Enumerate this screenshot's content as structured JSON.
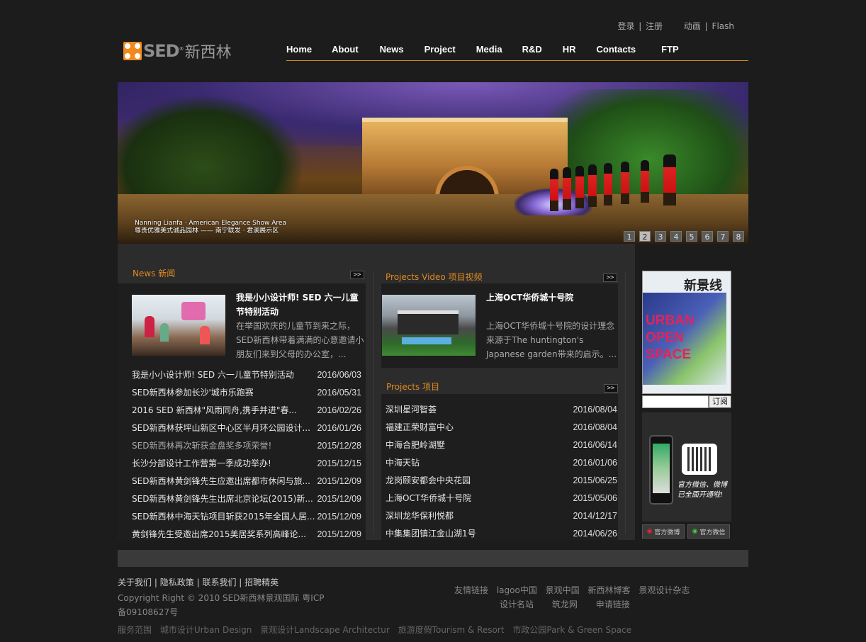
{
  "top_links": {
    "login": "登录",
    "register": "注册",
    "anim": "动画",
    "flash": "Flash",
    "sep": "|"
  },
  "logo": {
    "brand": "SED",
    "reg": "®",
    "cn": "新西林"
  },
  "nav": [
    "Home",
    "About",
    "News",
    "Project",
    "Media",
    "R&D",
    "HR",
    "Contacts",
    "FTP"
  ],
  "banner": {
    "caption_en": "Nanning Lianfa · American Elegance Show Area",
    "caption_cn": "尊贵优雅美式诚品园林 —— 南宁联发 · 君澜展示区",
    "pages": [
      "1",
      "2",
      "3",
      "4",
      "5",
      "6",
      "7",
      "8"
    ],
    "active_page": 2
  },
  "news": {
    "title": "News 新闻",
    "more": ">>",
    "feature_title": "我是小小设计师! SED 六一儿童节特别活动",
    "feature_text": "在举国欢庆的儿童节到来之际，SED新西林带着满满的心意邀请小朋友们来到父母的办公室，...",
    "items": [
      {
        "t": "我是小小设计师! SED 六一儿童节特别活动",
        "d": "2016/06/03"
      },
      {
        "t": "SED新西林参加长沙'城市乐跑赛",
        "d": "2016/05/31"
      },
      {
        "t": "2016 SED 新西林\"风雨同舟,携手并进\"春...",
        "d": "2016/02/26"
      },
      {
        "t": "SED新西林获坪山新区中心区半月环公园设计...",
        "d": "2016/01/26"
      },
      {
        "t": "SED新西林再次斩获金盘奖多项荣誉!",
        "d": "2015/12/28"
      },
      {
        "t": "长沙分部设计工作营第一季成功举办!",
        "d": "2015/12/15"
      },
      {
        "t": "SED新西林黄剑锋先生应邀出席都市休闲与旅...",
        "d": "2015/12/09"
      },
      {
        "t": "SED新西林黄剑锋先生出席北京论坛(2015)新...",
        "d": "2015/12/09"
      },
      {
        "t": "SED新西林中海天钻项目斩获2015年全国人居...",
        "d": "2015/12/09"
      },
      {
        "t": "黄剑锋先生受邀出席2015美居奖系列高峰论...",
        "d": "2015/12/09"
      }
    ]
  },
  "video": {
    "title": "Projects Video 项目视频",
    "more": ">>",
    "feature_title": "上海OCT华侨城十号院",
    "feature_text": "上海OCT华侨城十号院的设计理念来源于The huntington's Japanese garden带来的启示。..."
  },
  "projects": {
    "title": "Projects 项目",
    "more": ">>",
    "items": [
      {
        "t": "深圳星河智荟",
        "d": "2016/08/04"
      },
      {
        "t": "福建正荣财富中心",
        "d": "2016/08/04"
      },
      {
        "t": "中海合肥岭湖墅",
        "d": "2016/06/14"
      },
      {
        "t": "中海天钻",
        "d": "2016/01/06"
      },
      {
        "t": "龙岗颐安都会中央花园",
        "d": "2015/06/25"
      },
      {
        "t": "上海OCT华侨城十号院",
        "d": "2015/05/06"
      },
      {
        "t": "深圳龙华保利悦都",
        "d": "2014/12/17"
      },
      {
        "t": "中集集团镇江金山湖1号",
        "d": "2014/06/26"
      }
    ]
  },
  "sidebar": {
    "mag_title": "新景线",
    "mag_words": [
      "URBAN",
      "OPEN",
      "SPACE"
    ],
    "subscribe": "订阅",
    "qr_line1": "官方微信、微博",
    "qr_line2": "已全面开通啦!",
    "weibo": "官方微博",
    "weixin": "官方微信"
  },
  "footer": {
    "links": [
      "关于我们",
      "隐私政策",
      "联系我们",
      "招聘精英"
    ],
    "sep": "|",
    "copyright": "Copyright Right © 2010 SED新西林景观国际 粤ICP备09108627号",
    "friends_line1": [
      "友情链接",
      "lagoo中国",
      "景观中国",
      "新西林博客",
      "景观设计杂志"
    ],
    "friends_line2": [
      "设计名站",
      "筑龙网",
      "申请链接"
    ],
    "services": [
      "服务范围",
      "城市设计Urban Design",
      "景观设计Landscape Architectur",
      "旅游度假Tourism & Resort",
      "市政公园Park & Green Space"
    ]
  }
}
